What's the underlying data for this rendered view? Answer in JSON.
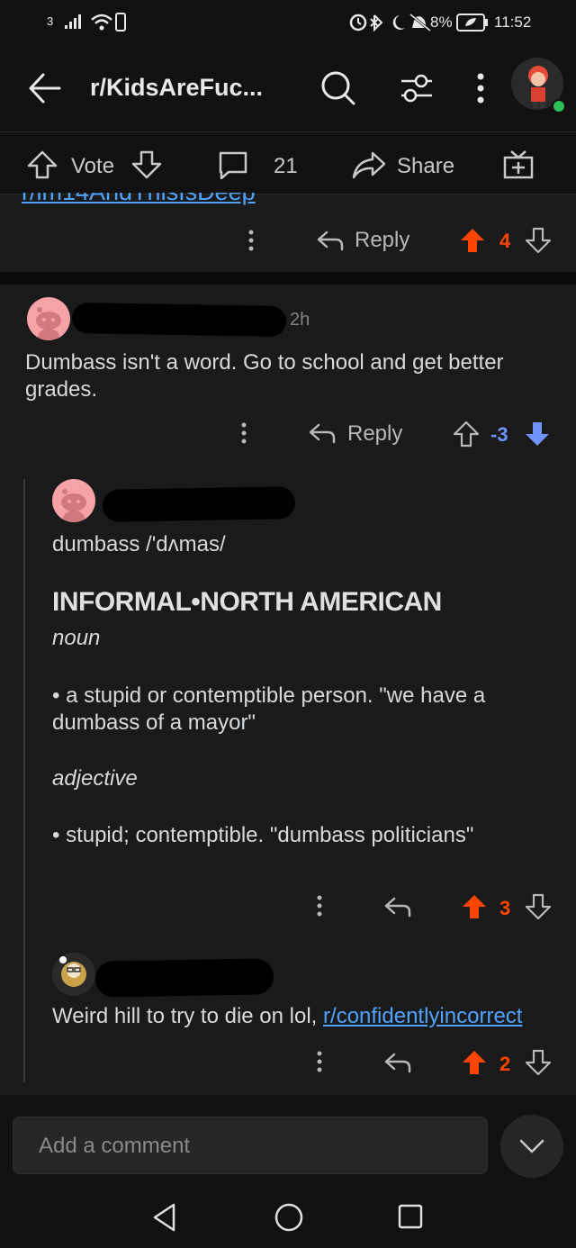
{
  "status_bar": {
    "sim": "3",
    "battery": "8%",
    "time": "11:52"
  },
  "header": {
    "subreddit": "r/KidsAreFuc..."
  },
  "post_actions": {
    "vote_label": "Vote",
    "comment_count": "21",
    "share_label": "Share"
  },
  "prev_comment": {
    "cut_link": "r/im14AndThisIsDeep",
    "reply_label": "Reply",
    "score": "4"
  },
  "comment_1": {
    "time": "2h",
    "body": "Dumbass isn't a word. Go to school and get better grades.",
    "reply_label": "Reply",
    "score": "-3"
  },
  "comment_2": {
    "headword": "dumbass /'dʌmas/",
    "register": "INFORMAL•NORTH AMERICAN",
    "pos_1": "noun",
    "def_1": "• a stupid or contemptible person. \"we have a dumbass of a mayor\"",
    "pos_2": "adjective",
    "def_2": "• stupid; contemptible. \"dumbass politicians\"",
    "score": "3"
  },
  "comment_3": {
    "body_prefix": "Weird hill to try to die on lol, ",
    "link": "r/confidentlyincorrect",
    "score": "2"
  },
  "comment_box": {
    "placeholder": "Add a comment"
  },
  "colors": {
    "upvote": "#ff4500",
    "downvote": "#7193ff",
    "link": "#4fa3ff",
    "background": "#1a1a1b"
  }
}
